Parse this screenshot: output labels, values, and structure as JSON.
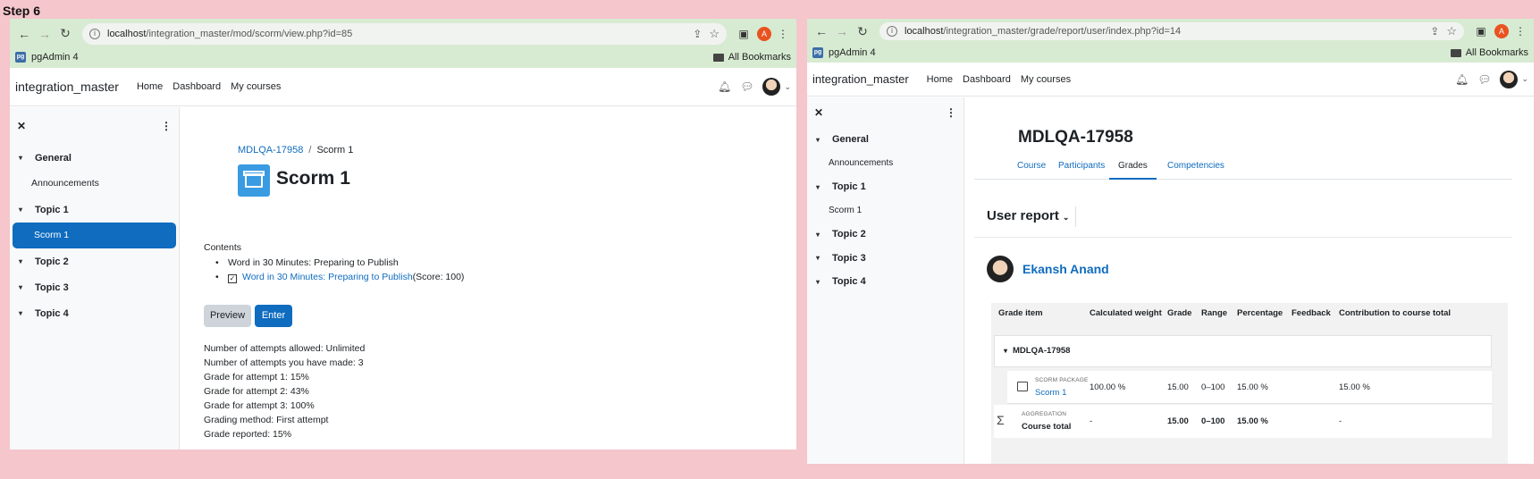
{
  "step_label": "Step 6",
  "left": {
    "url_host": "localhost",
    "url_path": "/integration_master/mod/scorm/view.php?id=85",
    "bookmark": "pgAdmin 4",
    "all_bookmarks": "All Bookmarks",
    "profile": "A",
    "brand": "integration_master",
    "nav": [
      "Home",
      "Dashboard",
      "My courses"
    ],
    "drawer": {
      "sections": [
        {
          "title": "General",
          "items": [
            "Announcements"
          ]
        },
        {
          "title": "Topic 1",
          "items": [
            "Scorm 1"
          ]
        },
        {
          "title": "Topic 2",
          "items": []
        },
        {
          "title": "Topic 3",
          "items": []
        },
        {
          "title": "Topic 4",
          "items": []
        }
      ],
      "active_item": "Scorm 1"
    },
    "breadcrumb": {
      "course": "MDLQA-17958",
      "separator": "/",
      "current": "Scorm 1"
    },
    "title": "Scorm 1",
    "contents_label": "Contents",
    "toc": {
      "item1": "Word in 30 Minutes: Preparing to Publish",
      "item2_link": "Word in 30 Minutes: Preparing to Publish",
      "item2_score": "(Score: 100)"
    },
    "buttons": {
      "preview": "Preview",
      "enter": "Enter"
    },
    "attempts": [
      "Number of attempts allowed: Unlimited",
      "Number of attempts you have made: 3",
      "Grade for attempt 1: 15%",
      "Grade for attempt 2: 43%",
      "Grade for attempt 3: 100%",
      "Grading method: First attempt",
      "Grade reported: 15%"
    ]
  },
  "right": {
    "url_host": "localhost",
    "url_path": "/integration_master/grade/report/user/index.php?id=14",
    "bookmark": "pgAdmin 4",
    "all_bookmarks": "All Bookmarks",
    "profile": "A",
    "brand": "integration_master",
    "nav": [
      "Home",
      "Dashboard",
      "My courses"
    ],
    "drawer": {
      "sections": [
        {
          "title": "General",
          "items": [
            "Announcements"
          ]
        },
        {
          "title": "Topic 1",
          "items": [
            "Scorm 1"
          ]
        },
        {
          "title": "Topic 2",
          "items": []
        },
        {
          "title": "Topic 3",
          "items": []
        },
        {
          "title": "Topic 4",
          "items": []
        }
      ]
    },
    "course_title": "MDLQA-17958",
    "tabs": [
      "Course",
      "Participants",
      "Grades",
      "Competencies"
    ],
    "selected_tab": "Grades",
    "report_selector": "User report",
    "user_name": "Ekansh Anand",
    "table": {
      "headers": [
        "Grade item",
        "Calculated weight",
        "Grade",
        "Range",
        "Percentage",
        "Feedback",
        "Contribution to course total"
      ],
      "category": "MDLQA-17958",
      "rows": [
        {
          "type": "SCORM PACKAGE",
          "name": "Scorm 1",
          "weight": "100.00 %",
          "grade": "15.00",
          "range": "0–100",
          "percentage": "15.00 %",
          "feedback": "",
          "contribution": "15.00 %"
        },
        {
          "type": "AGGREGATION",
          "name": "Course total",
          "weight": "-",
          "grade": "15.00",
          "range": "0–100",
          "percentage": "15.00 %",
          "feedback": "",
          "contribution": "-"
        }
      ]
    }
  }
}
